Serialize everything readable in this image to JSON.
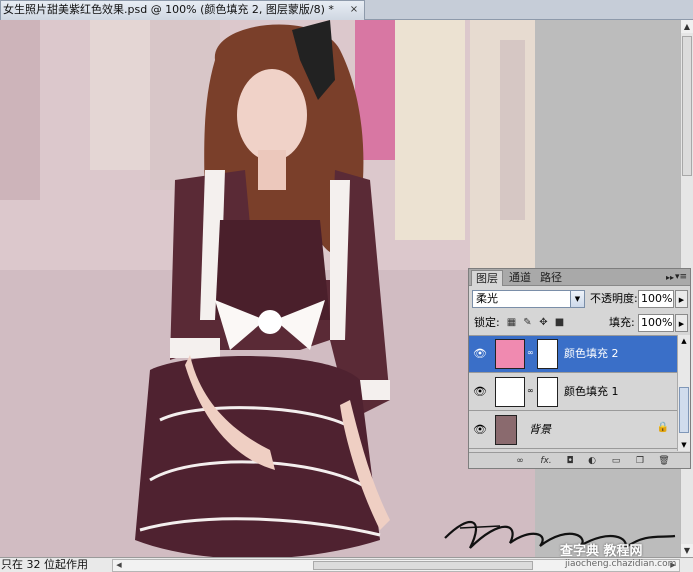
{
  "document": {
    "tab_title": "女生照片甜美紫红色效果.psd @ 100% (颜色填充 2, 图层蒙版/8) *",
    "close_glyph": "×"
  },
  "status_bar": {
    "text": "只在 32 位起作用"
  },
  "watermark": {
    "site": "查字典 教程网",
    "url": "jiaocheng.chazidian.com"
  },
  "layers_panel": {
    "tabs": [
      {
        "label": "图层",
        "active": true
      },
      {
        "label": "通道",
        "active": false
      },
      {
        "label": "路径",
        "active": false
      }
    ],
    "collapse_glyph": "▸▸",
    "menu_glyph": "▾≡",
    "blend_mode": "柔光",
    "opacity_label": "不透明度:",
    "opacity_value": "100%",
    "lock_label": "锁定:",
    "fill_label": "填充:",
    "fill_value": "100%",
    "layers": [
      {
        "name": "颜色填充 2",
        "selected": true,
        "thumb_color": "#f08ab0"
      },
      {
        "name": "颜色填充 1",
        "selected": false,
        "thumb_color": "#ffffff"
      },
      {
        "name": "背景",
        "selected": false,
        "thumb_color": "#8a6a6e"
      }
    ]
  },
  "colors": {
    "selection": "#3a6fc8",
    "dress": "#5a2a36",
    "fill_layer_2": "#f08ab0"
  }
}
